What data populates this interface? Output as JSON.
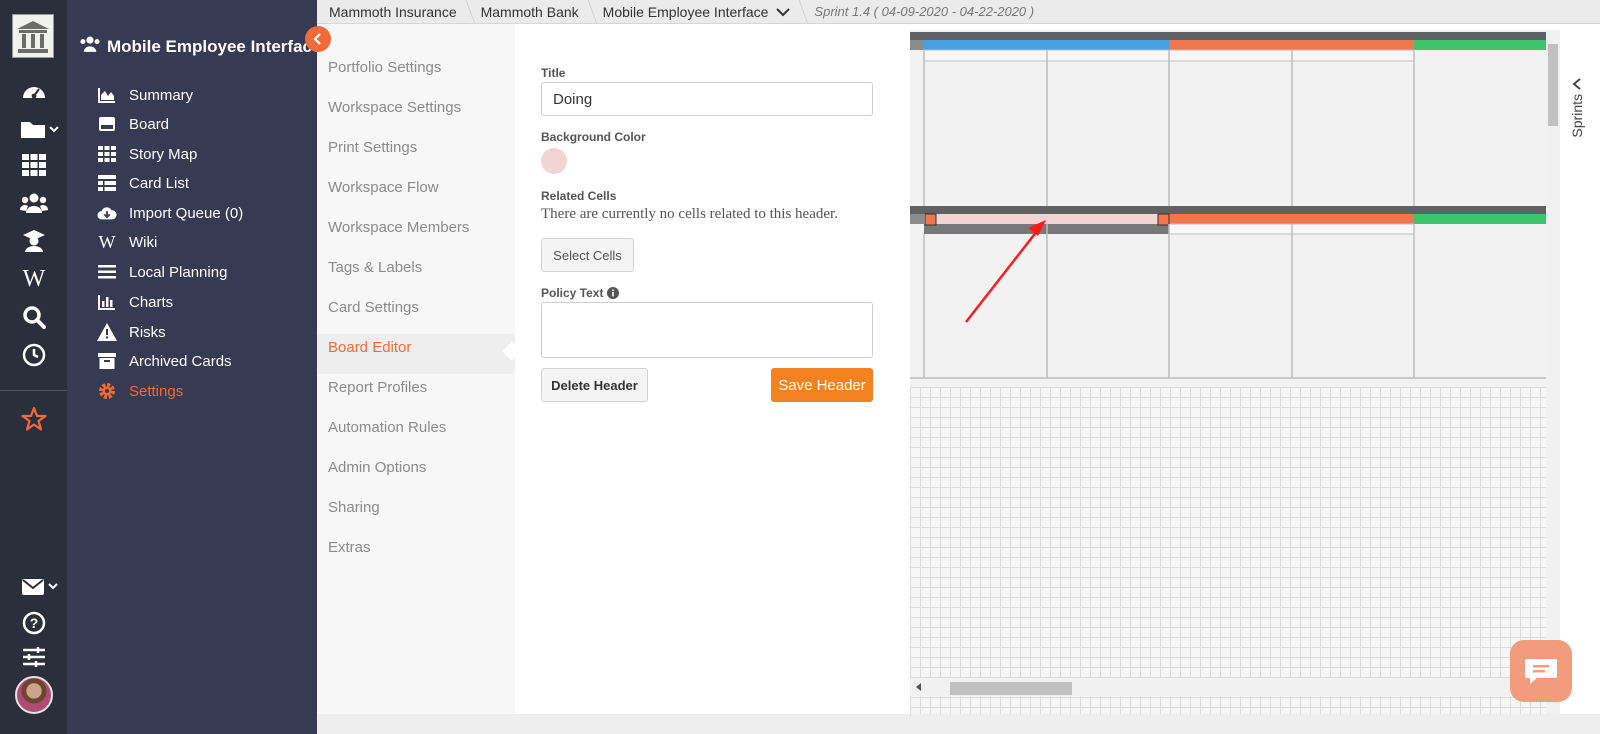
{
  "breadcrumbs": [
    "Mammoth Insurance",
    "Mammoth Bank",
    "Mobile Employee Interface"
  ],
  "sprint_label": "Sprint 1.4 ( 04-09-2020 - 04-22-2020 )",
  "workspace_title": "Mobile Employee Interface",
  "rail_icons": [
    "dashboard-icon",
    "folder-icon",
    "grid-icon",
    "team-icon",
    "graduate-icon",
    "wiki-icon",
    "search-icon",
    "clock-icon",
    "star-icon",
    "mail-icon",
    "help-icon",
    "sliders-icon"
  ],
  "nav": {
    "items": [
      {
        "label": "Summary",
        "icon": "area-chart-icon"
      },
      {
        "label": "Board",
        "icon": "board-icon"
      },
      {
        "label": "Story Map",
        "icon": "story-map-icon"
      },
      {
        "label": "Card List",
        "icon": "card-list-icon"
      },
      {
        "label": "Import Queue (0)",
        "icon": "cloud-download-icon"
      },
      {
        "label": "Wiki",
        "icon": "wiki-icon"
      },
      {
        "label": "Local Planning",
        "icon": "list-icon"
      },
      {
        "label": "Charts",
        "icon": "bar-chart-icon"
      },
      {
        "label": "Risks",
        "icon": "warning-icon"
      },
      {
        "label": "Archived Cards",
        "icon": "archive-icon"
      },
      {
        "label": "Settings",
        "icon": "gear-icon"
      }
    ],
    "active": "Settings"
  },
  "settings_menu": {
    "items": [
      "Portfolio Settings",
      "Workspace Settings",
      "Print Settings",
      "Workspace Flow",
      "Workspace Members",
      "Tags & Labels",
      "Card Settings",
      "Board Editor",
      "Report Profiles",
      "Automation Rules",
      "Admin Options",
      "Sharing",
      "Extras"
    ],
    "active": "Board Editor"
  },
  "form": {
    "title_label": "Title",
    "title_value": "Doing",
    "bg_color_label": "Background Color",
    "bg_color_value": "#f2d4d4",
    "related_cells_label": "Related Cells",
    "related_cells_text": "There are currently no cells related to this header.",
    "select_cells_button": "Select Cells",
    "policy_text_label": "Policy Text",
    "policy_text_value": "",
    "delete_button": "Delete Header",
    "save_button": "Save Header"
  },
  "sprints_tab_label": "Sprints",
  "colors": {
    "accent": "#f26b37",
    "rail_bg": "#2b2e3b",
    "nav_bg": "#363a53",
    "header_blue": "#4a9fe0",
    "header_orange": "#f0764e",
    "header_green": "#3ec46d",
    "header_dark": "#5f6163"
  }
}
